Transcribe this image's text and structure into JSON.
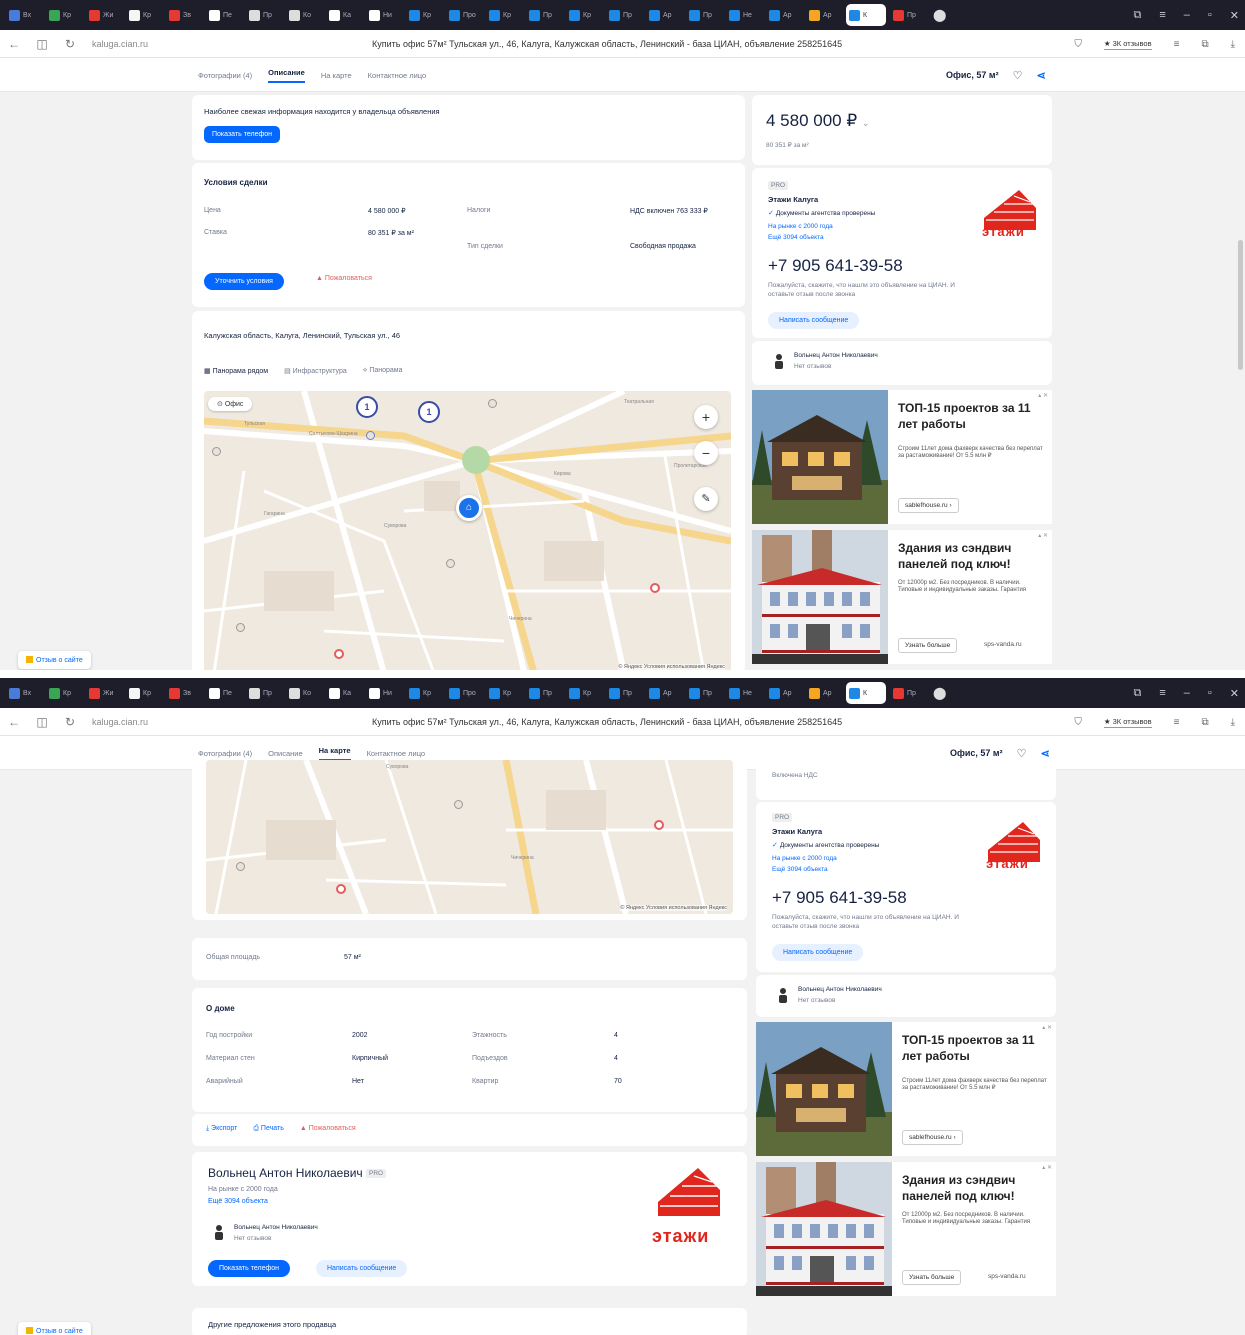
{
  "browser": {
    "tabs": [
      {
        "title": "Вх",
        "color": "#4a7bd8"
      },
      {
        "title": "Кр",
        "color": "#3aa655"
      },
      {
        "title": "Жи",
        "color": "#e53935"
      },
      {
        "title": "Кр",
        "color": "#f5f5f5"
      },
      {
        "title": "Зв",
        "color": "#e53935"
      },
      {
        "title": "Пе",
        "color": "#ffffff"
      },
      {
        "title": "Пр",
        "color": "#dddddd"
      },
      {
        "title": "Ко",
        "color": "#dddddd"
      },
      {
        "title": "Ка",
        "color": "#ffffff"
      },
      {
        "title": "Ни",
        "color": "#ffffff"
      },
      {
        "title": "Кр",
        "color": "#1e88e5"
      },
      {
        "title": "Про",
        "color": "#1e88e5"
      },
      {
        "title": "Кр",
        "color": "#1e88e5"
      },
      {
        "title": "Пр",
        "color": "#1e88e5"
      },
      {
        "title": "Кр",
        "color": "#1e88e5"
      },
      {
        "title": "Пр",
        "color": "#1e88e5"
      },
      {
        "title": "Ар",
        "color": "#1e88e5"
      },
      {
        "title": "Пр",
        "color": "#1e88e5"
      },
      {
        "title": "Не",
        "color": "#1e88e5"
      },
      {
        "title": "Ар",
        "color": "#1e88e5"
      },
      {
        "title": "Ар",
        "color": "#f5a623"
      }
    ],
    "active_tab": "К",
    "extra_tab": "Пр",
    "domain": "kaluga.cian.ru",
    "title_1": "Купить офис 57м² Тульская ул., 46, Калуга, Калужская область, Ленинский - база ЦИАН, объявление 258251645",
    "title_2": "Купить офис 57м² Тульская ул., 46, Калуга, Калужская область, Ленинский - база ЦИАН, объявление 258251645",
    "reviews_label": "★ 3К отзывов"
  },
  "nav": {
    "links": [
      "Фотографии (4)",
      "Описание",
      "На карте",
      "Контактное лицо"
    ],
    "active_1": 1,
    "active_2": 2,
    "offer_label": "Офис, 57 м²"
  },
  "top": {
    "notice": "Наиболее свежая информация находится у владельца объявления",
    "show_phone": "Показать телефон"
  },
  "deal": {
    "title": "Условия сделки",
    "rows": [
      {
        "label": "Цена",
        "value": "4 580 000 ₽"
      },
      {
        "label": "Ставка",
        "value": "80 351 ₽ за м²"
      }
    ],
    "rows_right": [
      {
        "label": "Налоги",
        "value": "НДС включен 763 333 ₽"
      },
      {
        "label": "Тип сделки",
        "value": "Свободная продажа"
      }
    ],
    "refine": "Уточнить условия",
    "complain": "Пожаловаться"
  },
  "address": {
    "text": "Калужская область, Калуга, Ленинский, Тульская ул., 46",
    "tabs": [
      "Панорама рядом",
      "Инфраструктура",
      "Панорама"
    ]
  },
  "map": {
    "flag": "Офис",
    "pins": [
      "1",
      "1"
    ],
    "zoom_in": "+",
    "zoom_out": "−",
    "ruler": "✎",
    "copyright": "© Яндекс  Условия использования  Яндекс",
    "labels": [
      "Тульская",
      "Салтыкова-Щедрина",
      "Суворова",
      "Пролетарская",
      "Чичерина",
      "Гагарина",
      "Кирова",
      "Театральная"
    ]
  },
  "sidebar": {
    "price": "4 580 000 ₽",
    "price_per_m": "80 351 ₽ за м²",
    "vat": "Включена НДС",
    "agency_tag": "PRO",
    "agency": "Этажи Калуга",
    "checked": "Документы агентства проверены",
    "on_market": "На рынке с 2000 года",
    "objects": "Ещё 3094 объекта",
    "phone": "+7 905 641-39-58",
    "phone_note": "Пожалуйста, скажите, что нашли это объявление на ЦИАН. И оставьте отзыв после звонка",
    "write": "Написать сообщение",
    "agent": "Вольнец Антон Николаевич",
    "agent_reviews": "Нет отзывов",
    "logo_text": "этажи"
  },
  "ads": [
    {
      "title": "ТОП-15 проектов за 11 лет работы",
      "text": "Строим 11лет дома фахверк качества без переплат за растаможивание! От 5.5 млн ₽",
      "chip": "sablefhouse.ru ›",
      "chip2": ""
    },
    {
      "title": "Здания из сэндвич панелей под ключ!",
      "text": "От 12000р м2. Без посредников. В наличии. Типовые и индивидуальные заказы. Гарантия",
      "chip": "Узнать больше",
      "chip2": "sps-vanda.ru"
    }
  ],
  "about": {
    "area_label": "Общая площадь",
    "area_value": "57 м²",
    "title": "О доме",
    "left": [
      {
        "label": "Год постройки",
        "value": "2002"
      },
      {
        "label": "Материал стен",
        "value": "Кирпичный"
      },
      {
        "label": "Аварийный",
        "value": "Нет"
      }
    ],
    "right": [
      {
        "label": "Этажность",
        "value": "4"
      },
      {
        "label": "Подъездов",
        "value": "4"
      },
      {
        "label": "Квартир",
        "value": "70"
      }
    ],
    "export": "Экспорт",
    "print": "Печать",
    "complain": "Пожаловаться"
  },
  "seller": {
    "name": "Вольнец Антон Николаевич",
    "tag": "PRO",
    "on_market": "На рынке с 2000 года",
    "objects": "Ещё 3094 объекта",
    "agent": "Вольнец Антон Николаевич",
    "agent_reviews": "Нет отзывов",
    "show_phone": "Показать телефон",
    "write": "Написать сообщение",
    "logo_text": "этажи"
  },
  "other_offers": "Другие предложения этого продавца",
  "float_btn": "Отзыв о сайте",
  "colors": {
    "accent": "#0468ff",
    "brand_red": "#e0261d",
    "text": "#152242"
  }
}
